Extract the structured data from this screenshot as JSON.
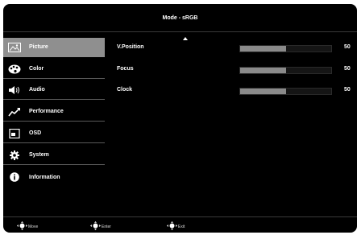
{
  "header": {
    "title": "Mode - sRGB"
  },
  "sidebar": {
    "items": [
      {
        "label": "Picture",
        "icon": "picture-icon",
        "active": true
      },
      {
        "label": "Color",
        "icon": "palette-icon"
      },
      {
        "label": "Audio",
        "icon": "speaker-icon"
      },
      {
        "label": "Performance",
        "icon": "trend-icon"
      },
      {
        "label": "OSD",
        "icon": "osd-window-icon"
      },
      {
        "label": "System",
        "icon": "gear-icon"
      },
      {
        "label": "Information",
        "icon": "info-icon"
      }
    ]
  },
  "settings": [
    {
      "label": "V.Position",
      "value": "50",
      "level": 0.5
    },
    {
      "label": "Focus",
      "value": "50",
      "level": 0.5
    },
    {
      "label": "Clock",
      "value": "50",
      "level": 0.5
    }
  ],
  "footer": {
    "move": "Move",
    "enter": "Enter",
    "exit": "Exit"
  },
  "colors": {
    "background": "#000000",
    "active_item": "#8f8f8f",
    "bar_fill": "#8a8a8a"
  }
}
